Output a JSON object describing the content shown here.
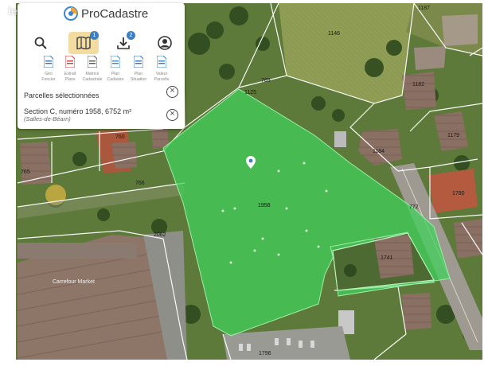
{
  "watermark": {
    "text": "leboncoin"
  },
  "app": {
    "name": "ProCadastre"
  },
  "toolbar": {
    "map_badge": "1",
    "download_badge": "2"
  },
  "documents": [
    {
      "label_1": "Géo",
      "label_2": "Foncier",
      "color": "#3a6fc2"
    },
    {
      "label_1": "Extrait",
      "label_2": "Plans",
      "color": "#d23c3c"
    },
    {
      "label_1": "Matrice",
      "label_2": "Cadastrale",
      "color": "#777777"
    },
    {
      "label_1": "Plan",
      "label_2": "Cadastre",
      "color": "#3a88c9"
    },
    {
      "label_1": "Plan",
      "label_2": "Situation",
      "color": "#3a6fc2"
    },
    {
      "label_1": "Valeur",
      "label_2": "Parcelle",
      "color": "#2f80c8"
    }
  ],
  "selection": {
    "heading": "Parcelles sélectionnées",
    "parcel_line": "Section C, numéro 1958, 6752 m²",
    "commune": "(Salles-de-Béarn)"
  },
  "map": {
    "parcel_labels": [
      {
        "text": "1146"
      },
      {
        "text": "1187"
      },
      {
        "text": "1182"
      },
      {
        "text": "1184"
      },
      {
        "text": "1179"
      },
      {
        "text": "1780"
      },
      {
        "text": "760"
      },
      {
        "text": "765"
      },
      {
        "text": "766"
      },
      {
        "text": "1958"
      },
      {
        "text": "1741"
      },
      {
        "text": "2062"
      },
      {
        "text": "1796"
      },
      {
        "text": "765"
      },
      {
        "text": "1125"
      },
      {
        "text": "772"
      }
    ],
    "poi": {
      "text": "Carrefour Market"
    },
    "selection_color": "#3fd35a"
  }
}
